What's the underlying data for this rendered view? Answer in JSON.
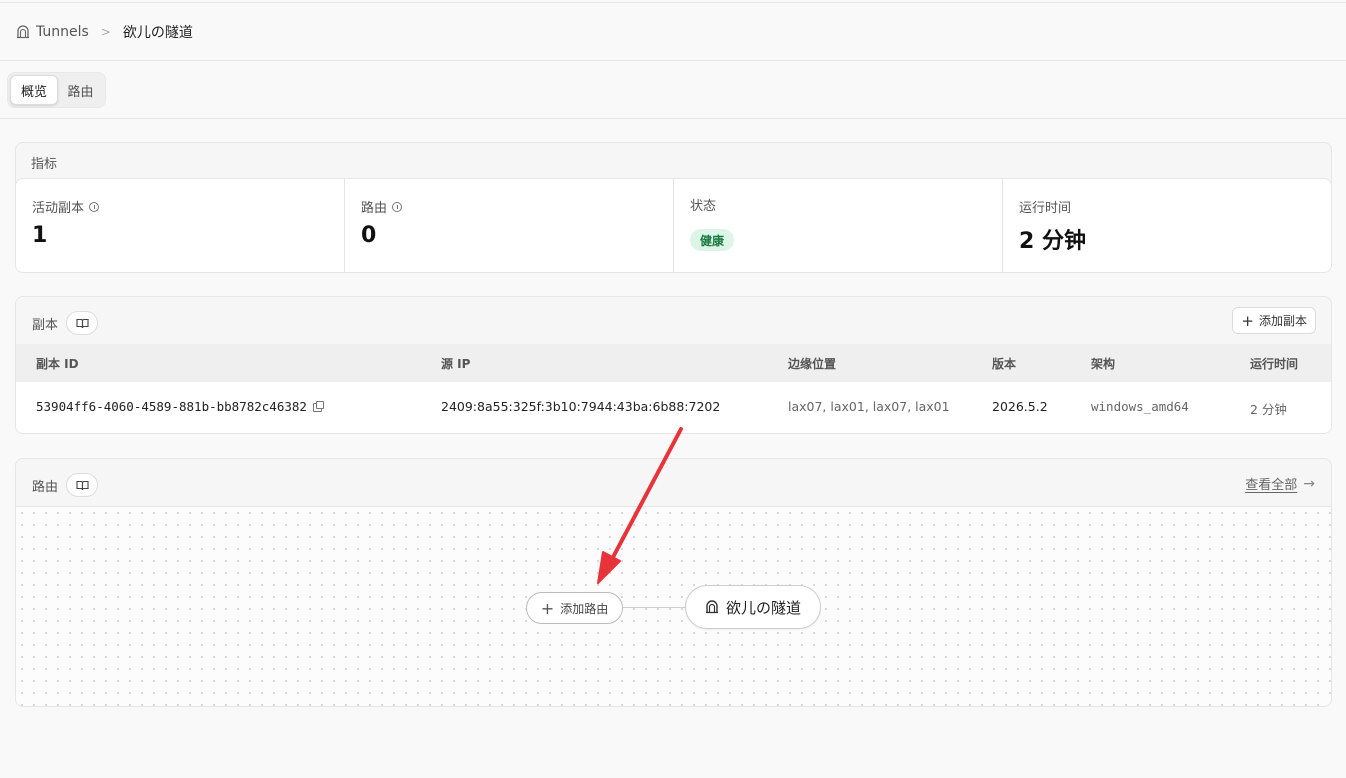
{
  "breadcrumb": {
    "root": "Tunnels",
    "separator": ">",
    "current": "欲儿の隧道"
  },
  "tabs": [
    {
      "label": "概览",
      "active": true
    },
    {
      "label": "路由",
      "active": false
    }
  ],
  "metrics": {
    "title": "指标",
    "active_replicas": {
      "label": "活动副本",
      "value": "1"
    },
    "routes": {
      "label": "路由",
      "value": "0"
    },
    "status": {
      "label": "状态",
      "value": "健康"
    },
    "uptime": {
      "label": "运行时间",
      "value": "2 分钟"
    }
  },
  "replicas": {
    "title": "副本",
    "add_button": "添加副本",
    "columns": {
      "id": "副本 ID",
      "source_ip": "源 IP",
      "edge": "边缘位置",
      "version": "版本",
      "arch": "架构",
      "uptime": "运行时间"
    },
    "rows": [
      {
        "id": "53904ff6-4060-4589-881b-bb8782c46382",
        "source_ip": "2409:8a55:325f:3b10:7944:43ba:6b88:7202",
        "edge": "lax07, lax01, lax07, lax01",
        "version": "2026.5.2",
        "arch": "windows_amd64",
        "uptime": "2 分钟"
      }
    ]
  },
  "routes": {
    "title": "路由",
    "view_all": "查看全部",
    "add_route": "添加路由",
    "tunnel_node": "欲儿の隧道"
  },
  "colors": {
    "badge_bg": "#dcf5e6",
    "badge_text": "#1b7a43",
    "annotation_arrow": "#e8333a"
  }
}
